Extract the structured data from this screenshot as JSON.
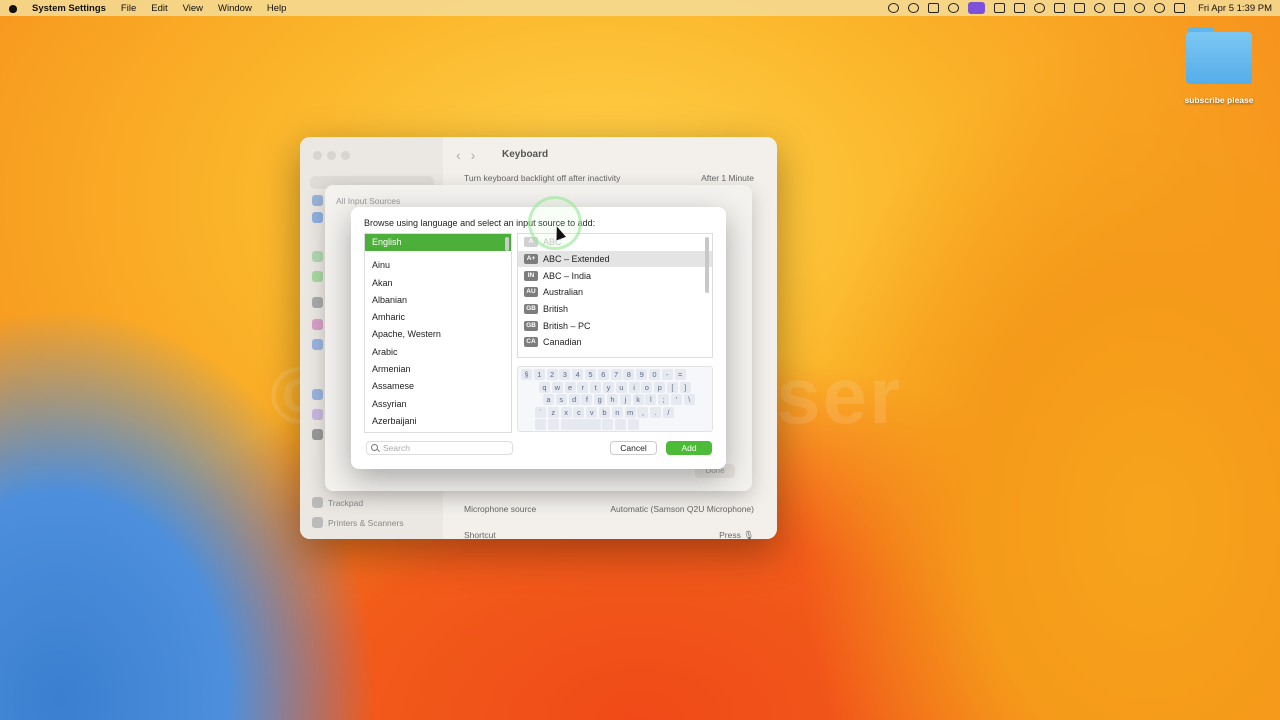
{
  "menubar": {
    "app_name": "System Settings",
    "menus": [
      "File",
      "Edit",
      "View",
      "Window",
      "Help"
    ],
    "clock": "Fri Apr 5  1:39 PM"
  },
  "desktop": {
    "folder_label": "subscribe please",
    "watermark": "© Tech Browser"
  },
  "settings_window": {
    "title": "Keyboard",
    "search_placeholder": "Search",
    "rows": [
      {
        "label": "Turn keyboard backlight off after inactivity",
        "value": "After 1 Minute"
      },
      {
        "label": "Microphone source",
        "value": "Automatic (Samson Q2U Microphone)"
      },
      {
        "label": "Shortcut",
        "value": "Press 🎙"
      }
    ],
    "sidebar_items": [
      "Trackpad",
      "Printers & Scanners"
    ]
  },
  "input_sources_sheet": {
    "label": "All Input Sources",
    "done_label": "Done"
  },
  "dialog": {
    "prompt": "Browse using language and select an input source to add:",
    "languages": [
      {
        "name": "English",
        "selected": true
      },
      {
        "name": "Ainu"
      },
      {
        "name": "Akan"
      },
      {
        "name": "Albanian"
      },
      {
        "name": "Amharic"
      },
      {
        "name": "Apache, Western"
      },
      {
        "name": "Arabic"
      },
      {
        "name": "Armenian"
      },
      {
        "name": "Assamese"
      },
      {
        "name": "Assyrian"
      },
      {
        "name": "Azerbaijani"
      }
    ],
    "sources": [
      {
        "badge": "A",
        "name": "ABC",
        "state": "dim"
      },
      {
        "badge": "A+",
        "name": "ABC – Extended",
        "state": "selected"
      },
      {
        "badge": "IN",
        "name": "ABC – India"
      },
      {
        "badge": "AU",
        "name": "Australian"
      },
      {
        "badge": "GB",
        "name": "British"
      },
      {
        "badge": "GB",
        "name": "British – PC"
      },
      {
        "badge": "CA",
        "name": "Canadian"
      }
    ],
    "keyboard_rows": [
      [
        "§",
        "1",
        "2",
        "3",
        "4",
        "5",
        "6",
        "7",
        "8",
        "9",
        "0",
        "-",
        "="
      ],
      [
        "q",
        "w",
        "e",
        "r",
        "t",
        "y",
        "u",
        "i",
        "o",
        "p",
        "[",
        "]"
      ],
      [
        "a",
        "s",
        "d",
        "f",
        "g",
        "h",
        "j",
        "k",
        "l",
        ";",
        "'",
        "\\"
      ],
      [
        "`",
        "z",
        "x",
        "c",
        "v",
        "b",
        "n",
        "m",
        ",",
        ".",
        "/"
      ]
    ],
    "search_placeholder": "Search",
    "cancel_label": "Cancel",
    "add_label": "Add",
    "accent": "#4cbb38"
  }
}
